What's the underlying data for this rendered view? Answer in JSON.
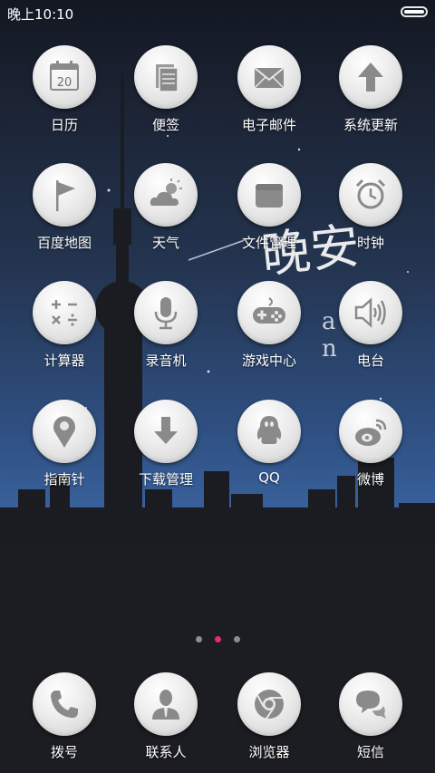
{
  "status": {
    "time": "晚上10:10"
  },
  "apps": [
    {
      "label": "日历",
      "icon": "calendar-icon",
      "date": "20"
    },
    {
      "label": "便签",
      "icon": "notes-icon"
    },
    {
      "label": "电子邮件",
      "icon": "mail-icon"
    },
    {
      "label": "系统更新",
      "icon": "update-arrow-icon"
    },
    {
      "label": "百度地图",
      "icon": "map-flag-icon"
    },
    {
      "label": "天气",
      "icon": "weather-icon"
    },
    {
      "label": "文件管理",
      "icon": "folder-icon"
    },
    {
      "label": "时钟",
      "icon": "alarm-clock-icon"
    },
    {
      "label": "计算器",
      "icon": "calculator-icon"
    },
    {
      "label": "录音机",
      "icon": "microphone-icon"
    },
    {
      "label": "游戏中心",
      "icon": "gamepad-icon"
    },
    {
      "label": "电台",
      "icon": "speaker-icon"
    },
    {
      "label": "指南针",
      "icon": "location-pin-icon"
    },
    {
      "label": "下载管理",
      "icon": "download-icon"
    },
    {
      "label": "QQ",
      "icon": "qq-penguin-icon"
    },
    {
      "label": "微博",
      "icon": "weibo-icon"
    }
  ],
  "dock": [
    {
      "label": "拨号",
      "icon": "phone-icon"
    },
    {
      "label": "联系人",
      "icon": "contact-icon"
    },
    {
      "label": "浏览器",
      "icon": "browser-icon"
    },
    {
      "label": "短信",
      "icon": "message-icon"
    }
  ],
  "pager": {
    "count": 3,
    "active": 2
  },
  "wallpaper": {
    "script_text": "晚安",
    "latin_text": "a n"
  },
  "colors": {
    "accent": "#e0306a",
    "icon_fg": "#8a8a8a"
  }
}
